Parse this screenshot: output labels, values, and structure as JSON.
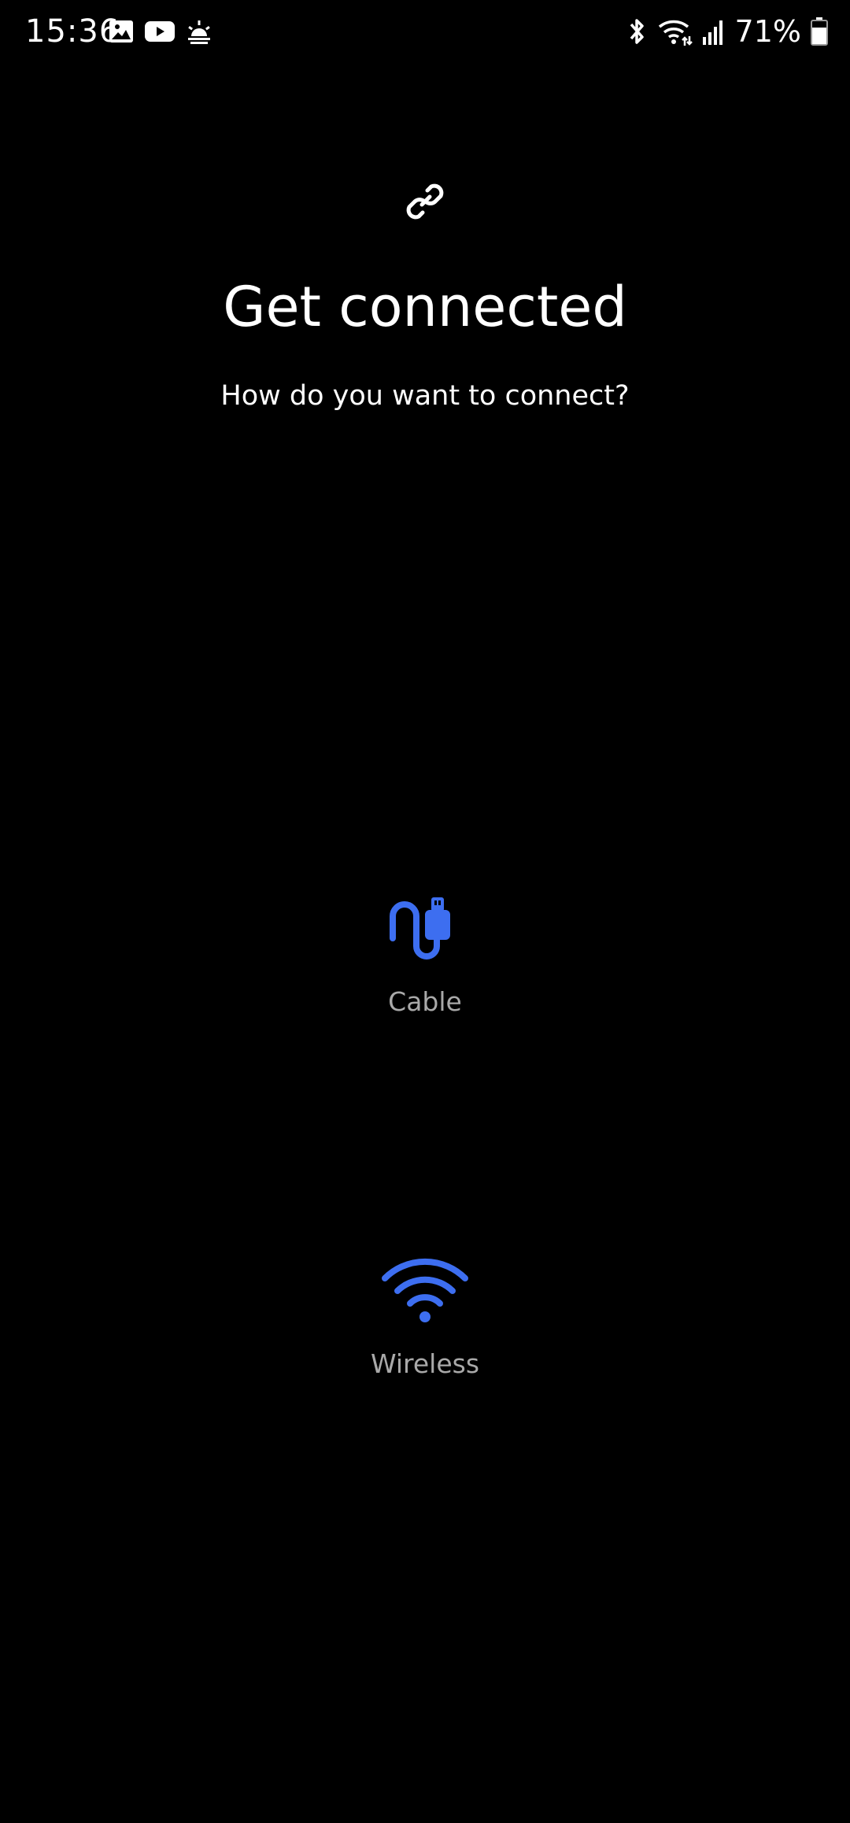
{
  "status_bar": {
    "time": "15:36",
    "left_icons": [
      "gallery-icon",
      "youtube-icon",
      "weather-sunrise-icon"
    ],
    "right_icons": [
      "bluetooth-icon",
      "wifi-icon",
      "signal-icon"
    ],
    "battery_percent": "71%",
    "battery_level": 0.71
  },
  "header": {
    "icon": "link-icon",
    "title": "Get connected",
    "subtitle": "How do you want to connect?"
  },
  "options": {
    "cable": {
      "label": "Cable",
      "icon": "cable-icon"
    },
    "wireless": {
      "label": "Wireless",
      "icon": "wifi-icon"
    }
  },
  "colors": {
    "background": "#000000",
    "accent": "#3d6ef0",
    "label": "#a9a9a9",
    "text": "#ffffff"
  }
}
